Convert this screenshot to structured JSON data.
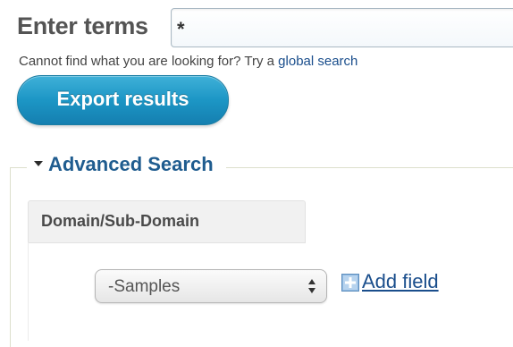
{
  "search": {
    "label": "Enter terms",
    "value": "*"
  },
  "hint": {
    "text": "Cannot find what you are looking for? Try a ",
    "link": "global search"
  },
  "export_button": "Export results",
  "advanced": {
    "legend": "Advanced Search",
    "tab_label": "Domain/Sub-Domain",
    "select_value": "-Samples",
    "add_field": "Add field",
    "add_icon": "add-field-icon"
  },
  "colors": {
    "accent": "#1c96c5",
    "link": "#1a4e8c",
    "legend": "#1f5c8f"
  }
}
